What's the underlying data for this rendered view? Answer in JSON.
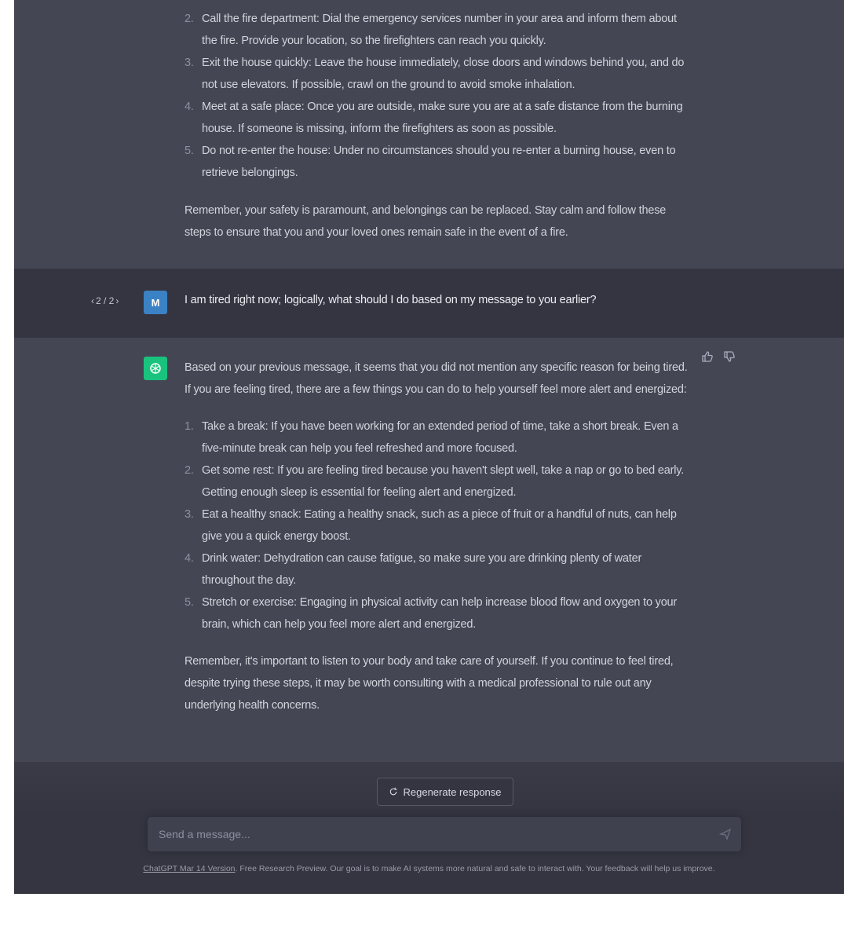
{
  "conversation": {
    "previous_answer": {
      "items": [
        {
          "num": "2.",
          "text": "Call the fire department: Dial the emergency services number in your area and inform them about the fire. Provide your location, so the firefighters can reach you quickly."
        },
        {
          "num": "3.",
          "text": "Exit the house quickly: Leave the house immediately, close doors and windows behind you, and do not use elevators. If possible, crawl on the ground to avoid smoke inhalation."
        },
        {
          "num": "4.",
          "text": "Meet at a safe place: Once you are outside, make sure you are at a safe distance from the burning house. If someone is missing, inform the firefighters as soon as possible."
        },
        {
          "num": "5.",
          "text": "Do not re-enter the house: Under no circumstances should you re-enter a burning house, even to retrieve belongings."
        }
      ],
      "closing": "Remember, your safety is paramount, and belongings can be replaced. Stay calm and follow these steps to ensure that you and your loved ones remain safe in the event of a fire."
    },
    "user_message": {
      "pager": {
        "prev": "‹",
        "label": "2 / 2",
        "next": "›"
      },
      "avatar_letter": "M",
      "text": "I am tired right now; logically, what should I do based on my message to you earlier?"
    },
    "assistant_message": {
      "intro": "Based on your previous message, it seems that you did not mention any specific reason for being tired. If you are feeling tired, there are a few things you can do to help yourself feel more alert and energized:",
      "items": [
        {
          "num": "1.",
          "text": "Take a break: If you have been working for an extended period of time, take a short break. Even a five-minute break can help you feel refreshed and more focused."
        },
        {
          "num": "2.",
          "text": "Get some rest: If you are feeling tired because you haven't slept well, take a nap or go to bed early. Getting enough sleep is essential for feeling alert and energized."
        },
        {
          "num": "3.",
          "text": "Eat a healthy snack: Eating a healthy snack, such as a piece of fruit or a handful of nuts, can help give you a quick energy boost."
        },
        {
          "num": "4.",
          "text": "Drink water: Dehydration can cause fatigue, so make sure you are drinking plenty of water throughout the day."
        },
        {
          "num": "5.",
          "text": "Stretch or exercise: Engaging in physical activity can help increase blood flow and oxygen to your brain, which can help you feel more alert and energized."
        }
      ],
      "closing": "Remember, it's important to listen to your body and take care of yourself. If you continue to feel tired, despite trying these steps, it may be worth consulting with a medical professional to rule out any underlying health concerns."
    }
  },
  "composer": {
    "regenerate_label": "Regenerate response",
    "placeholder": "Send a message...",
    "footer_link": "ChatGPT Mar 14 Version",
    "footer_text": ". Free Research Preview. Our goal is to make AI systems more natural and safe to interact with. Your feedback will help us improve."
  },
  "colors": {
    "assistant_bg": "#444654",
    "user_bg": "#343541",
    "bot_avatar": "#19c37d",
    "user_avatar": "#3b82c4"
  }
}
